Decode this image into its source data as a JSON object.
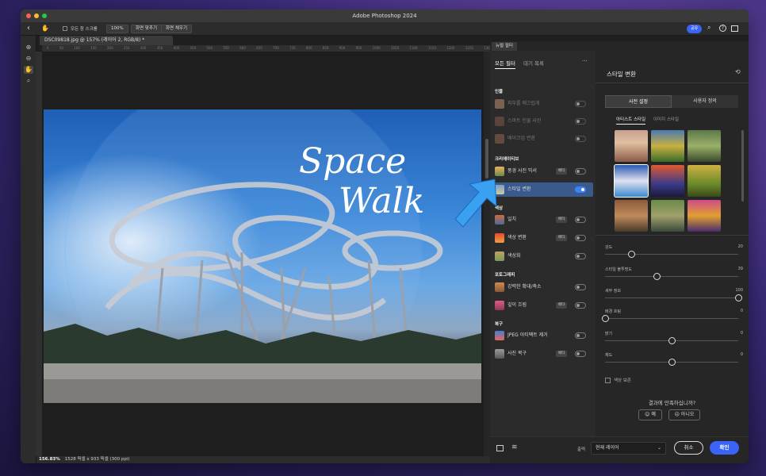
{
  "app": {
    "title": "Adobe Photoshop 2024"
  },
  "options_bar": {
    "scroll_all_label": "모든 창 스크롤",
    "zoom_100": "100%",
    "fit_screen": "화면 맞추기",
    "fill_screen": "화면 채우기",
    "share": "공유"
  },
  "document": {
    "tab_title": "DSC09818.jpg @ 157% (레이어 2, RGB/8) *",
    "ruler_ticks": "0 50 100 150 200 250 300 350 400 450 500 550 600 650 700 750 800 850 900 950 1000 1050 1100 1150 1200 1250 1300 1350 1400 1450 1500",
    "overlay_line1": "Space",
    "overlay_line2": "Walk",
    "zoom_status": "156.83%",
    "size_status": "1528 픽셀 x 933 픽셀 (300 ppi)"
  },
  "neural_filters": {
    "panel_tab": "뉴럴 필터",
    "tab_all": "모든 필터",
    "tab_waitlist": "대기 목록",
    "more": "···",
    "categories": [
      {
        "name": "인물",
        "items": [
          {
            "label": "피부를 매끄럽게",
            "disabled": true,
            "beta": false
          },
          {
            "label": "스마트 인물 사진",
            "disabled": true,
            "beta": false
          },
          {
            "label": "메이크업 변환",
            "disabled": true,
            "beta": false
          }
        ]
      },
      {
        "name": "크리에이티브",
        "items": [
          {
            "label": "풍경 사진 믹서",
            "disabled": false,
            "beta": true,
            "beta_label": "베타"
          },
          {
            "label": "스타일 변환",
            "disabled": false,
            "beta": false,
            "selected": true
          }
        ]
      },
      {
        "name": "색상",
        "items": [
          {
            "label": "일치",
            "disabled": false,
            "beta": true,
            "beta_label": "베타"
          },
          {
            "label": "색상 변환",
            "disabled": false,
            "beta": true,
            "beta_label": "베타"
          },
          {
            "label": "색상화",
            "disabled": false,
            "beta": false
          }
        ]
      },
      {
        "name": "포토그래피",
        "items": [
          {
            "label": "강력한 확대/축소",
            "disabled": false,
            "beta": false
          },
          {
            "label": "깊이 흐림",
            "disabled": false,
            "beta": true,
            "beta_label": "베타"
          }
        ]
      },
      {
        "name": "복구",
        "items": [
          {
            "label": "JPEG 아티팩트 제거",
            "disabled": false,
            "beta": false
          },
          {
            "label": "사진 복구",
            "disabled": false,
            "beta": true,
            "beta_label": "베타"
          }
        ]
      }
    ]
  },
  "style_transfer": {
    "title": "스타일 변환",
    "seg_preset": "사전 설정",
    "seg_custom": "사용자 정의",
    "subtab_artist": "아티스트 스타일",
    "subtab_image": "이미지 스타일",
    "sliders": [
      {
        "label": "강도",
        "value": "20",
        "fraction": 0.2
      },
      {
        "label": "스타일 불투명도",
        "value": "39",
        "fraction": 0.39
      },
      {
        "label": "세부 정보",
        "value": "100",
        "fraction": 1.0
      },
      {
        "label": "배경 흐림",
        "value": "0",
        "fraction": 0.0
      },
      {
        "label": "밝기",
        "value": "0",
        "fraction": 0.5
      },
      {
        "label": "채도",
        "value": "0",
        "fraction": 0.5
      }
    ],
    "preserve_color": "색상 보존",
    "question": "결과에 만족하십니까?",
    "yes": "예",
    "no": "아니오"
  },
  "footer": {
    "output_label": "출력",
    "output_value": "현재 레이어",
    "cancel": "취소",
    "ok": "확인"
  },
  "colors": {
    "accent": "#3b63f5",
    "selected_row": "#3b5a8c",
    "pointer_arrow": "#3aa0f0"
  }
}
